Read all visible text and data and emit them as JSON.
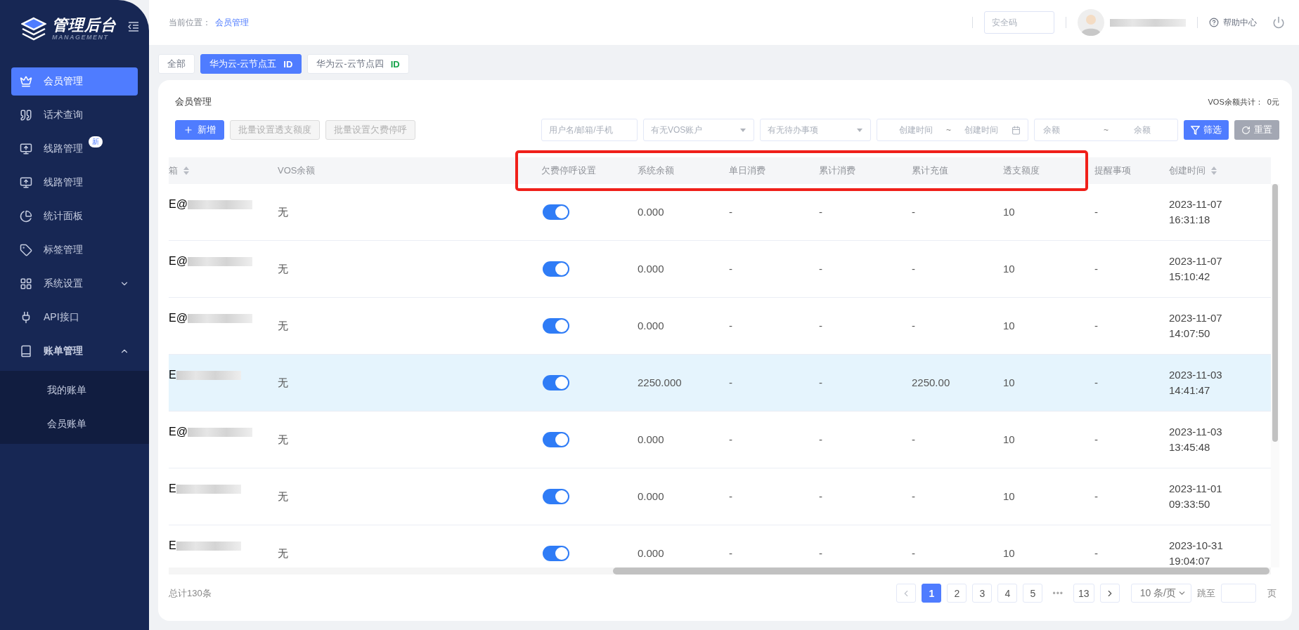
{
  "sidebar": {
    "logo": {
      "title": "管理后台",
      "subtitle": "MANAGEMENT"
    },
    "items": [
      {
        "label": "会员管理",
        "selected": true
      },
      {
        "label": "话术查询",
        "selected": false
      },
      {
        "label": "线路管理",
        "selected": false,
        "badge": "新"
      },
      {
        "label": "线路管理",
        "selected": false
      },
      {
        "label": "统计面板",
        "selected": false
      },
      {
        "label": "标签管理",
        "selected": false
      },
      {
        "label": "系统设置",
        "selected": false,
        "expanded": false
      },
      {
        "label": "API接口",
        "selected": false
      },
      {
        "label": "账单管理",
        "selected": false,
        "expanded": true,
        "children": [
          {
            "label": "我的账单",
            "selected": false
          },
          {
            "label": "会员账单",
            "selected": false
          }
        ]
      }
    ]
  },
  "header": {
    "breadcrumb_label": "当前位置：",
    "breadcrumb_current": "会员管理",
    "security_code": {
      "placeholder": "安全码"
    },
    "help": "帮助中心"
  },
  "node_tabs": [
    {
      "label": "全部",
      "selected": false
    },
    {
      "label": "华为云-云节点五",
      "tag": "ID",
      "selected": true
    },
    {
      "label": "华为云-云节点四",
      "tag": "ID",
      "selected": false
    }
  ],
  "card": {
    "title": "会员管理",
    "summary": "VOS余额共计：  0元",
    "actions": [
      {
        "label": "新增",
        "kind": "primary",
        "disabled": false
      },
      {
        "label": "批量设置透支额度",
        "kind": "plain",
        "disabled": true
      },
      {
        "label": "批量设置欠费停呼",
        "kind": "plain",
        "disabled": true
      }
    ],
    "filters": [
      {
        "kind": "text",
        "placeholder": "用户名/邮箱/手机"
      },
      {
        "kind": "select",
        "placeholder": "有无VOS账户"
      },
      {
        "kind": "select",
        "placeholder": "有无待办事项"
      },
      {
        "kind": "daterange",
        "placeholder": "创建时间",
        "placeholder_end": "创建时间",
        "separator": "~"
      },
      {
        "kind": "range",
        "placeholder": "余额",
        "placeholder_end": "余额",
        "separator": "~"
      }
    ],
    "filter_button": "筛选",
    "reset_button": "重置"
  },
  "table": {
    "columns": [
      {
        "kind": "column",
        "label": "箱",
        "sortable": true
      },
      {
        "kind": "column",
        "label": "VOS余额",
        "sortable": false
      },
      {
        "kind": "highlight_frame",
        "columns": [
          {
            "label": "欠费停呼设置",
            "sortable": false
          },
          {
            "label": "系统余额",
            "sortable": false
          },
          {
            "label": "单日消费",
            "sortable": false
          },
          {
            "label": "累计消费",
            "sortable": false
          },
          {
            "label": "累计充值",
            "sortable": false
          },
          {
            "label": "透支额度",
            "sortable": false
          }
        ]
      },
      {
        "kind": "column",
        "label": "提醒事项",
        "sortable": false
      },
      {
        "kind": "column",
        "label": "创建时间",
        "sortable": true
      }
    ],
    "rows": [
      {
        "email": "E@",
        "vos": "无",
        "stop_on": true,
        "balance": "0.000",
        "daily": "-",
        "total_cost": "-",
        "total_recharge": "-",
        "overdraft": "10",
        "reminder": "-",
        "created_date": "2023-11-07",
        "created_time": "16:31:18",
        "selected": false
      },
      {
        "email": "E@",
        "vos": "无",
        "stop_on": true,
        "balance": "0.000",
        "daily": "-",
        "total_cost": "-",
        "total_recharge": "-",
        "overdraft": "10",
        "reminder": "-",
        "created_date": "2023-11-07",
        "created_time": "15:10:42",
        "selected": false
      },
      {
        "email": "E@",
        "vos": "无",
        "stop_on": true,
        "balance": "0.000",
        "daily": "-",
        "total_cost": "-",
        "total_recharge": "-",
        "overdraft": "10",
        "reminder": "-",
        "created_date": "2023-11-07",
        "created_time": "14:07:50",
        "selected": false
      },
      {
        "email": "E",
        "vos": "无",
        "stop_on": true,
        "balance": "2250.000",
        "daily": "-",
        "total_cost": "-",
        "total_recharge": "2250.00",
        "overdraft": "10",
        "reminder": "-",
        "created_date": "2023-11-03",
        "created_time": "14:41:47",
        "selected": true
      },
      {
        "email": "E@",
        "vos": "无",
        "stop_on": true,
        "balance": "0.000",
        "daily": "-",
        "total_cost": "-",
        "total_recharge": "-",
        "overdraft": "10",
        "reminder": "-",
        "created_date": "2023-11-03",
        "created_time": "13:45:48",
        "selected": false
      },
      {
        "email": "E",
        "vos": "无",
        "stop_on": true,
        "balance": "0.000",
        "daily": "-",
        "total_cost": "-",
        "total_recharge": "-",
        "overdraft": "10",
        "reminder": "-",
        "created_date": "2023-11-01",
        "created_time": "09:33:50",
        "selected": false
      },
      {
        "email": "E",
        "vos": "无",
        "stop_on": true,
        "balance": "0.000",
        "daily": "-",
        "total_cost": "-",
        "total_recharge": "-",
        "overdraft": "10",
        "reminder": "-",
        "created_date": "2023-10-31",
        "created_time": "19:04:07",
        "selected": false
      }
    ]
  },
  "pagination": {
    "total": "总计130条",
    "pages": [
      {
        "label": "1",
        "selected": true
      },
      {
        "label": "2",
        "selected": false
      },
      {
        "label": "3",
        "selected": false
      },
      {
        "label": "4",
        "selected": false
      },
      {
        "label": "5",
        "selected": false
      },
      {
        "label": "•••",
        "kind": "ellipsis"
      },
      {
        "label": "13",
        "selected": false
      }
    ],
    "prev_disabled": true,
    "next_disabled": false,
    "page_size": "10 条/页",
    "jump_label": "跳至",
    "page_unit": "页"
  }
}
